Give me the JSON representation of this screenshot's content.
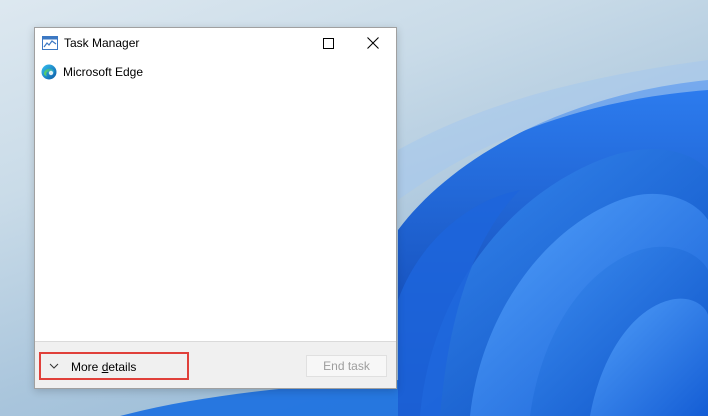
{
  "window": {
    "title": "Task Manager",
    "controls": {
      "minimize_icon": "minimize-icon",
      "maximize_icon": "maximize-icon",
      "close_icon": "close-icon"
    }
  },
  "processes": [
    {
      "name": "Microsoft Edge",
      "icon": "edge-icon"
    }
  ],
  "footer": {
    "more_details_prefix": "More ",
    "more_details_accel": "d",
    "more_details_suffix": "etails",
    "end_task_label": "End task"
  },
  "colors": {
    "highlight": "#e0403a",
    "wallpaper_blue": "#1a6fe0"
  }
}
